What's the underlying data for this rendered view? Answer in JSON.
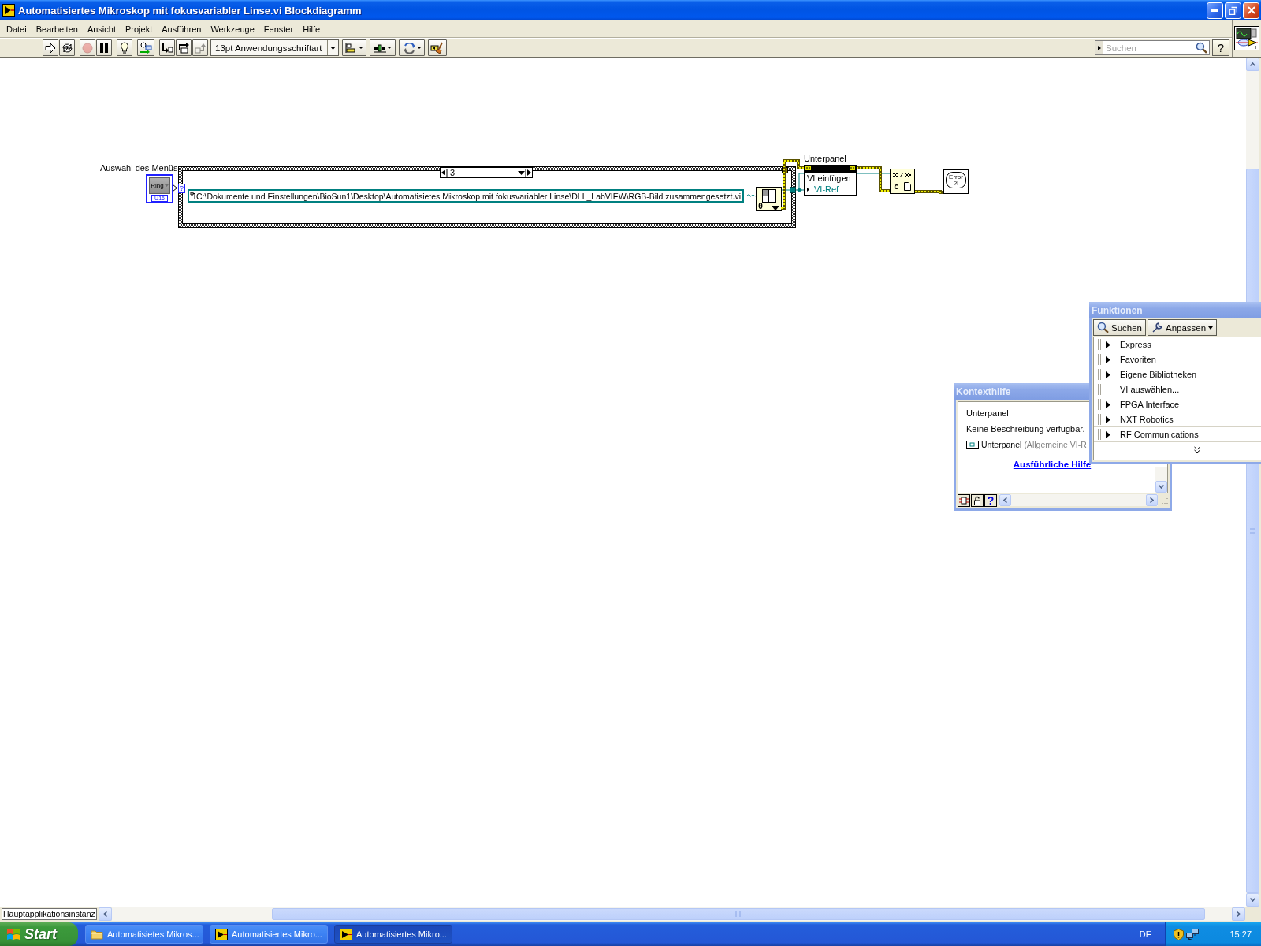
{
  "window": {
    "title": "Automatisiertes Mikroskop mit fokusvariabler Linse.vi Blockdiagramm"
  },
  "menu": [
    {
      "label": "Datei"
    },
    {
      "label": "Bearbeiten"
    },
    {
      "label": "Ansicht"
    },
    {
      "label": "Projekt"
    },
    {
      "label": "Ausführen"
    },
    {
      "label": "Werkzeuge"
    },
    {
      "label": "Fenster"
    },
    {
      "label": "Hilfe"
    }
  ],
  "toolbar": {
    "tool_groups": [
      [
        {
          "kind": "run",
          "disabled": false
        },
        {
          "kind": "run-continuously",
          "disabled": false
        }
      ],
      [
        {
          "kind": "abort",
          "disabled": true
        },
        {
          "kind": "pause",
          "disabled": false
        }
      ],
      [
        {
          "kind": "highlight",
          "disabled": false
        }
      ],
      [
        {
          "kind": "retain-values",
          "disabled": false
        }
      ],
      [
        {
          "kind": "step-into",
          "disabled": false
        },
        {
          "kind": "step-over",
          "disabled": false
        },
        {
          "kind": "step-out",
          "disabled": true
        }
      ]
    ],
    "font": "13pt Anwendungsschriftart",
    "arrange_tools": [
      {
        "kind": "align"
      },
      {
        "kind": "distribute"
      },
      {
        "kind": "reorder"
      },
      {
        "kind": "cleanup"
      }
    ],
    "search": {
      "placeholder": "Suchen"
    },
    "help_button": "?"
  },
  "diagram": {
    "ring": {
      "label": "Auswahl des Menüs",
      "caption": "Ring",
      "datatype": "U16"
    },
    "case_structure": {
      "selector_terminal": "?",
      "case": "3",
      "path": "C:\\Dokumente und Einstellungen\\BioSun1\\Desktop\\Automatisietes Mikroskop mit fokusvariabler Linse\\DLL_LabVIEW\\RGB-Bild zusammengesetzt.vi"
    },
    "open_node": {
      "caption": "0"
    },
    "property_node": {
      "label": "Unterpanel",
      "property": "VI einfügen",
      "input": "VI-Ref"
    },
    "close_node": {
      "caption": "c"
    },
    "error_node": {
      "caption": "Error",
      "mark": "?!"
    }
  },
  "context_help": {
    "title": "Kontexthilfe",
    "heading": "Unterpanel",
    "description": "Keine Beschreibung verfügbar.",
    "item": "Unterpanel",
    "item_note": "(Allgemeine VI-R",
    "link": "Ausführliche Hilfe",
    "help_button": "?"
  },
  "functions_palette": {
    "title": "Funktionen",
    "search_button": "Suchen",
    "customize_button": "Anpassen",
    "items": [
      {
        "label": "Express",
        "kind": "submenu"
      },
      {
        "label": "Favoriten",
        "kind": "submenu"
      },
      {
        "label": "Eigene Bibliotheken",
        "kind": "submenu"
      },
      {
        "label": "VI auswählen...",
        "kind": "command"
      },
      {
        "label": "FPGA Interface",
        "kind": "submenu"
      },
      {
        "label": "NXT Robotics",
        "kind": "submenu"
      },
      {
        "label": "RF Communications",
        "kind": "submenu"
      }
    ]
  },
  "status_bar": {
    "context": "Hauptapplikationsinstanz"
  },
  "taskbar": {
    "start": "Start",
    "tasks": [
      {
        "label": "Automatisietes Mikros...",
        "kind": "folder",
        "selected": false
      },
      {
        "label": "Automatisiertes Mikro...",
        "kind": "vi",
        "selected": false
      },
      {
        "label": "Automatisiertes Mikro...",
        "kind": "vi",
        "selected": true
      }
    ],
    "language": "DE",
    "clock": "15:27"
  }
}
